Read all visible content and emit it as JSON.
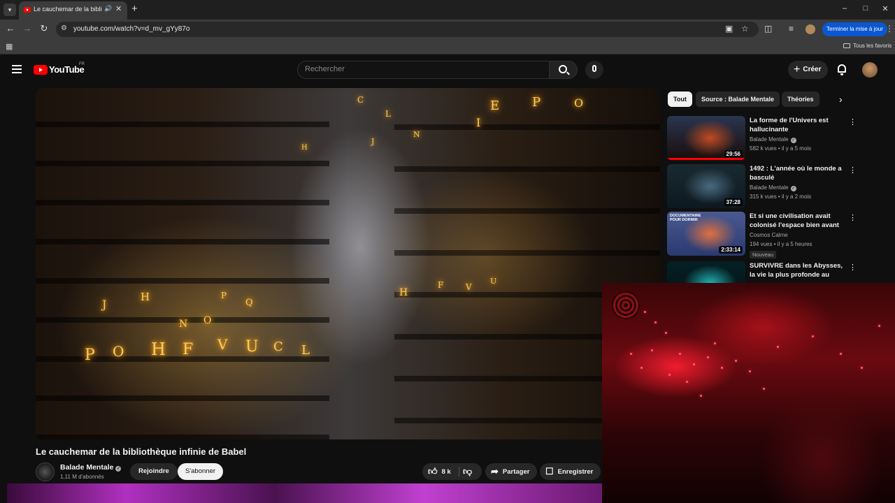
{
  "browser": {
    "tab_title": "Le cauchemar de la bibliothèque infinie de Babel",
    "url": "youtube.com/watch?v=d_mv_gYy87o",
    "update_button": "Terminer la mise à jour",
    "all_bookmarks": "Tous les favoris"
  },
  "masthead": {
    "logo_text": "YouTube",
    "country_code": "FR",
    "search_placeholder": "Rechercher",
    "create_label": "Créer"
  },
  "chips": [
    "Tout",
    "Source : Balade Mentale",
    "Théories"
  ],
  "recommendations": [
    {
      "title": "La forme de l'Univers est hallucinante",
      "channel": "Balade Mentale",
      "verified": true,
      "meta": "582 k vues • il y a 5 mois",
      "duration": "29:56",
      "badge": "",
      "progress": 1.0,
      "thumb_colors": [
        "#1a0d0a",
        "#c04a20",
        "#2a3550"
      ]
    },
    {
      "title": "1492 : L'année où le monde a basculé",
      "channel": "Balade Mentale",
      "verified": true,
      "meta": "315 k vues • il y a 2 mois",
      "duration": "37:28",
      "badge": "",
      "progress": 0,
      "thumb_colors": [
        "#0d1820",
        "#4a6a80",
        "#1a2a30"
      ]
    },
    {
      "title": "Et si une civilisation avait colonisé l'espace bien avant ...",
      "channel": "Cosmos Calme",
      "verified": false,
      "meta": "194 vues • il y a 5 heures",
      "duration": "2:33:14",
      "badge": "Nouveau",
      "progress": 0,
      "thumb_colors": [
        "#2a3a70",
        "#e07040",
        "#4a5a90"
      ],
      "thumb_text": "DOCUMENTAIRE POUR DORMIR"
    },
    {
      "title": "SURVIVRE dans les Abysses, la vie la plus profonde au monde",
      "channel": "",
      "verified": false,
      "meta": "",
      "duration": "",
      "badge": "",
      "progress": 0,
      "thumb_colors": [
        "#051015",
        "#20b0b0",
        "#052025"
      ]
    }
  ],
  "video": {
    "title": "Le cauchemar de la bibliothèque infinie de Babel",
    "channel": "Balade Mentale",
    "subscribers": "1,11 M d'abonnés",
    "join_label": "Rejoindre",
    "subscribe_label": "S'abonner",
    "likes": "8 k",
    "share_label": "Partager",
    "save_label": "Enregistrer"
  },
  "colors": {
    "youtube_red": "#ff0000",
    "background": "#0f0f0f",
    "update_blue": "#0b57d0",
    "glyph_gold": "#ffcc55"
  }
}
